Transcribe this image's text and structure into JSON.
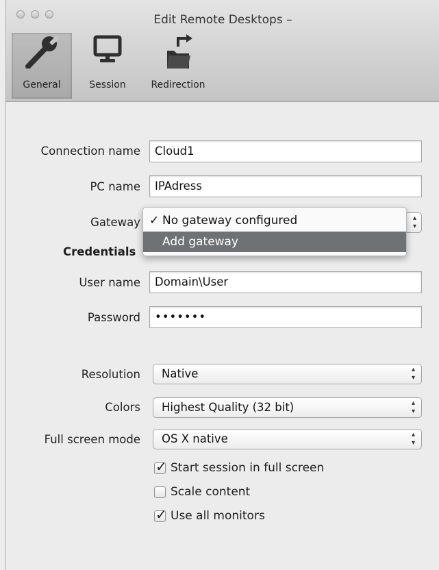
{
  "window": {
    "title": "Edit Remote Desktops –"
  },
  "toolbar": {
    "items": [
      {
        "label": "General",
        "selected": true,
        "icon": "wrench-icon"
      },
      {
        "label": "Session",
        "selected": false,
        "icon": "monitor-icon"
      },
      {
        "label": "Redirection",
        "selected": false,
        "icon": "folder-redirect-icon"
      }
    ]
  },
  "form": {
    "connection_name": {
      "label": "Connection name",
      "value": "Cloud1"
    },
    "pc_name": {
      "label": "PC name",
      "value": "IPAdress"
    },
    "gateway": {
      "label": "Gateway",
      "menu": [
        {
          "label": "No gateway configured",
          "checked": true,
          "check_glyph": "✓"
        },
        {
          "label": "Add gateway",
          "highlighted": true
        }
      ]
    },
    "credentials_heading": "Credentials",
    "user_name": {
      "label": "User name",
      "value": "Domain\\User"
    },
    "password": {
      "label": "Password",
      "value": "•••••••"
    },
    "resolution": {
      "label": "Resolution",
      "value": "Native"
    },
    "colors": {
      "label": "Colors",
      "value": "Highest Quality (32 bit)"
    },
    "full_screen_mode": {
      "label": "Full screen mode",
      "value": "OS X native"
    },
    "checkboxes": [
      {
        "label": "Start session in full screen",
        "checked": true
      },
      {
        "label": "Scale content",
        "checked": false
      },
      {
        "label": "Use all monitors",
        "checked": true
      }
    ],
    "popup_arrows": "▴\n▾"
  },
  "colors": {
    "menu_highlight": "#6e7274",
    "window_bg": "#ececec"
  }
}
